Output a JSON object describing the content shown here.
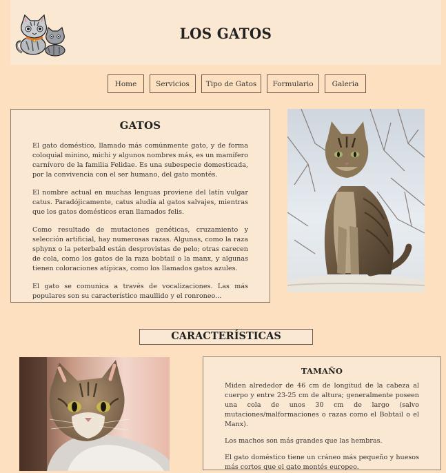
{
  "header": {
    "title": "LOS GATOS",
    "logo_icon": "cartoon-cats-logo-icon"
  },
  "nav": {
    "items": [
      "Home",
      "Servicios",
      "Tipo de Gatos",
      "Formulario",
      "Galeria"
    ]
  },
  "intro": {
    "heading": "GATOS",
    "paragraphs": [
      "El gato doméstico, llamado más comúnmente gato, y de forma coloquial minino, michi y algunos nombres más, es un mamífero carnívoro de la familia Felidae. Es una subespecie domesticada, por la convivencia con el ser humano, del gato montés.",
      "El nombre actual en muchas lenguas proviene del latín vulgar catus. Paradójicamente, catus aludía al gatos salvajes, mientras que los gatos domésticos eran llamados felis.",
      "Como resultado de mutaciones genéticas, cruzamiento y selección artificial, hay numerosas razas. Algunas, como la raza sphynx o la peterbald están desprovistas de pelo; otras carecen de cola, como los gatos de la raza bobtail o la manx, y algunas tienen coloraciones atípicas, como los llamados gatos azules.",
      "El gato se comunica a través de vocalizaciones. Las más populares son su característico maullido y el ronroneo..."
    ]
  },
  "characteristics": {
    "title": "CARACTERÍSTICAS"
  },
  "size": {
    "heading": "TAMAÑO",
    "paragraphs": [
      "Miden alrededor de 46 cm de longitud de la cabeza al cuerpo y entre 23-25 cm de altura; generalmente poseen una cola de unos 30 cm de largo (salvo mutaciones/malformaciones o razas como el Bobtail o el Manx).",
      "Los machos son más grandes que las hembras.",
      "El gato doméstico tiene un cráneo más pequeño y huesos más cortos que el gato montés europeo."
    ]
  },
  "colors": {
    "page_bg": "#fde0c0",
    "panel_bg": "#fbe8d2",
    "border": "#6b5a4c"
  }
}
